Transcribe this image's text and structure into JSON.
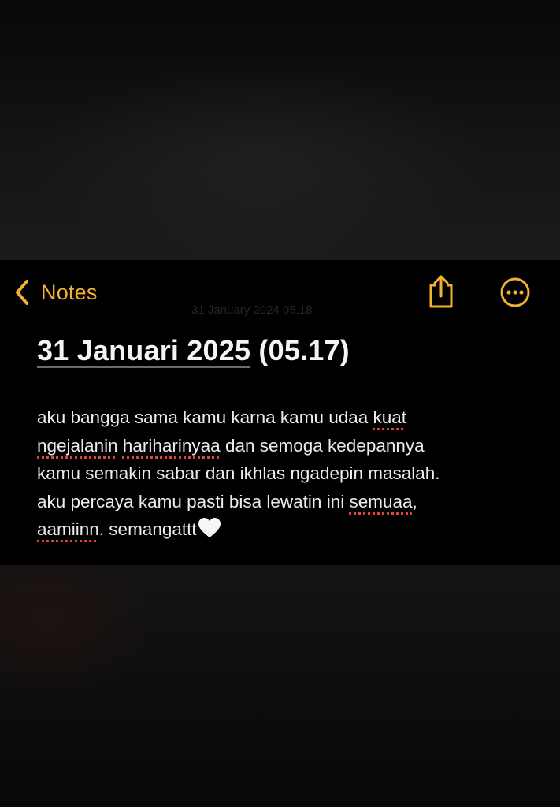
{
  "nav": {
    "back_label": "Notes",
    "back_icon": "chevron-left-icon",
    "share_icon": "share-icon",
    "more_icon": "ellipsis-circle-icon",
    "accent_color": "#f2b130"
  },
  "note": {
    "ghost_date": "31 January 2024 05.18",
    "title_link": "31 Januari 2025",
    "title_rest": " (05.17)",
    "body": {
      "l1_a": "aku bangga sama kamu karna kamu udaa ",
      "l1_b": "kuat",
      "l2_a": "ngejalanin",
      "l2_b": " ",
      "l2_c": "hariharinyaa",
      "l2_d": " dan semoga kedepannya",
      "l3": "kamu semakin sabar dan ikhlas ngadepin masalah.",
      "l4_a": "aku percaya kamu pasti bisa lewatin ini ",
      "l4_b": "semuaa",
      "l4_c": ",",
      "l5_a": "aamiinn",
      "l5_b": ". semangattt",
      "heart_icon": "white-heart-icon"
    }
  }
}
